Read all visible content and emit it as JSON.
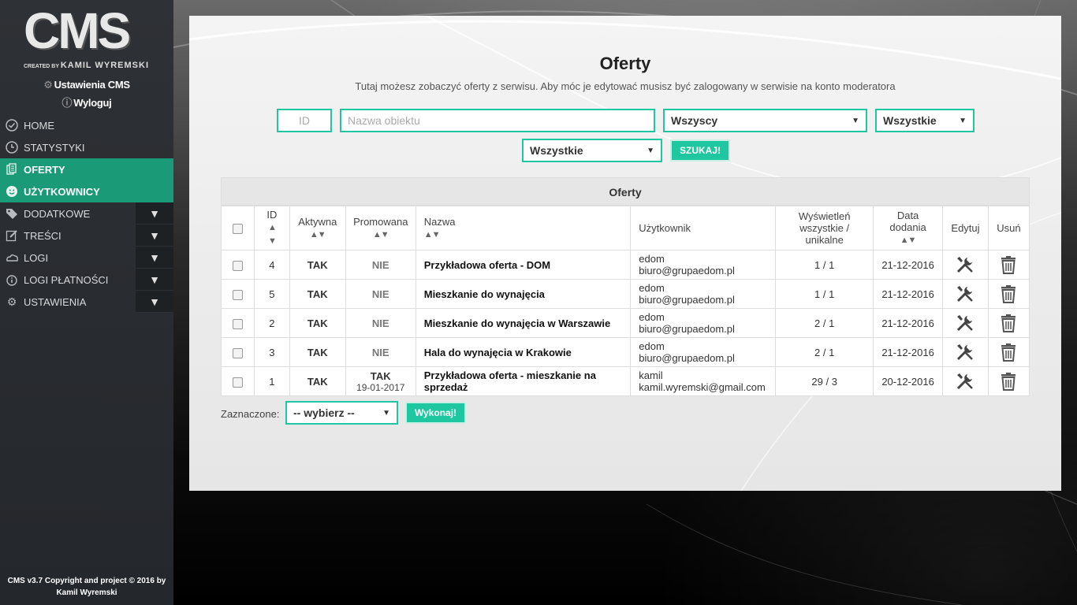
{
  "sidebar": {
    "logo_main": "CMS",
    "logo_created_by": "CREATED BY",
    "logo_author": "KAMIL WYREMSKI",
    "settings_link": "Ustawienia CMS",
    "logout_link": "Wyloguj",
    "items": [
      {
        "label": "HOME",
        "icon": "check-circle-icon"
      },
      {
        "label": "STATYSTYKI",
        "icon": "clock-icon"
      },
      {
        "label": "OFERTY",
        "icon": "documents-icon"
      },
      {
        "label": "UŻYTKOWNICY",
        "icon": "user-smile-icon"
      },
      {
        "label": "DODATKOWE",
        "icon": "tag-icon"
      },
      {
        "label": "TREŚCI",
        "icon": "edit-icon"
      },
      {
        "label": "LOGI",
        "icon": "cloud-icon"
      },
      {
        "label": "LOGI PŁATNOŚCI",
        "icon": "info-icon"
      },
      {
        "label": "USTAWIENIA",
        "icon": "gear-icon"
      }
    ],
    "footer_line1": "CMS v3.7 Copyright and project © 2016 by",
    "footer_line2": "Kamil Wyremski"
  },
  "main": {
    "title": "Oferty",
    "subtitle": "Tutaj możesz zobaczyć oferty z serwisu. Aby móc je edytować musisz być zalogowany w serwisie na konto moderatora",
    "filters": {
      "id_placeholder": "ID",
      "name_placeholder": "Nazwa obiektu",
      "user_select": "Wszyscy",
      "status_select": "Wszystkie",
      "promo_select": "Wszystkie",
      "search_button": "SZUKAJ!"
    },
    "table": {
      "caption": "Oferty",
      "headers": {
        "id": "ID",
        "active": "Aktywna",
        "promoted": "Promowana",
        "name": "Nazwa",
        "user": "Użytkownik",
        "views_line1": "Wyświetleń",
        "views_line2": "wszystkie /",
        "views_line3": "unikalne",
        "date_line1": "Data",
        "date_line2": "dodania",
        "edit": "Edytuj",
        "delete": "Usuń"
      },
      "rows": [
        {
          "id": "4",
          "active": "TAK",
          "promoted": "NIE",
          "promoted_date": "",
          "name": "Przykładowa oferta - DOM",
          "user_login": "edom",
          "user_email": "biuro@grupaedom.pl",
          "views": "1 / 1",
          "date": "21-12-2016"
        },
        {
          "id": "5",
          "active": "TAK",
          "promoted": "NIE",
          "promoted_date": "",
          "name": "Mieszkanie do wynajęcia",
          "user_login": "edom",
          "user_email": "biuro@grupaedom.pl",
          "views": "1 / 1",
          "date": "21-12-2016"
        },
        {
          "id": "2",
          "active": "TAK",
          "promoted": "NIE",
          "promoted_date": "",
          "name": "Mieszkanie do wynajęcia w Warszawie",
          "user_login": "edom",
          "user_email": "biuro@grupaedom.pl",
          "views": "2 / 1",
          "date": "21-12-2016"
        },
        {
          "id": "3",
          "active": "TAK",
          "promoted": "NIE",
          "promoted_date": "",
          "name": "Hala do wynajęcia w Krakowie",
          "user_login": "edom",
          "user_email": "biuro@grupaedom.pl",
          "views": "2 / 1",
          "date": "21-12-2016"
        },
        {
          "id": "1",
          "active": "TAK",
          "promoted": "TAK",
          "promoted_date": "19-01-2017",
          "name": "Przykładowa oferta - mieszkanie na sprzedaż",
          "user_login": "kamil",
          "user_email": "kamil.wyremski@gmail.com",
          "views": "29 / 3",
          "date": "20-12-2016"
        }
      ]
    },
    "bulk": {
      "label": "Zaznaczone:",
      "select": "-- wybierz --",
      "button": "Wykonaj!"
    }
  },
  "colors": {
    "accent": "#1fc7a0",
    "active_menu": "#1b9a78",
    "sidebar_bg": "#2e3135"
  }
}
